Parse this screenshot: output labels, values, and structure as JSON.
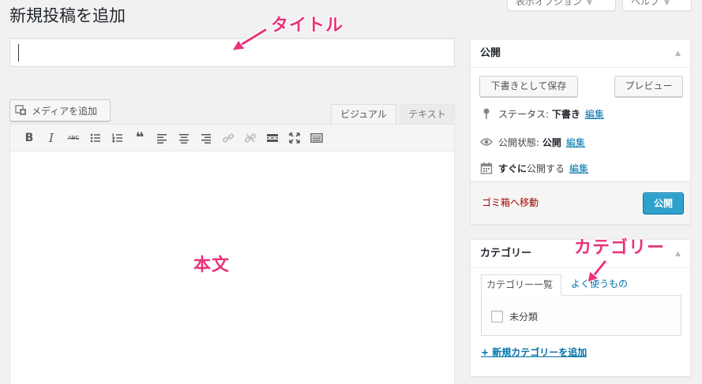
{
  "header": {
    "page_title": "新規投稿を追加",
    "screen_options_label": "表示オプション",
    "help_label": "ヘルプ"
  },
  "title_field": {
    "value": ""
  },
  "media": {
    "add_media_label": "メディアを追加"
  },
  "editor_tabs": {
    "visual": "ビジュアル",
    "text": "テキスト"
  },
  "toolbar": {
    "buttons": [
      "bold-icon",
      "italic-icon",
      "strikethrough-icon",
      "bullet-list-icon",
      "numbered-list-icon",
      "blockquote-icon",
      "align-left-icon",
      "align-center-icon",
      "align-right-icon",
      "insert-link-icon",
      "remove-link-icon",
      "read-more-icon",
      "fullscreen-icon",
      "toolbar-toggle-icon"
    ],
    "bold_glyph": "B",
    "italic_glyph": "I",
    "strike_glyph": "ABC",
    "quote_glyph": "❝"
  },
  "annotations": {
    "title": "タイトル",
    "body": "本文",
    "category": "カテゴリー",
    "color": "#e8327c"
  },
  "publish_box": {
    "heading": "公開",
    "save_draft": "下書きとして保存",
    "preview": "プレビュー",
    "status_label": "ステータス:",
    "status_value": "下書き",
    "visibility_label": "公開状態:",
    "visibility_value": "公開",
    "schedule_value": "すぐに",
    "schedule_label": "公開する",
    "edit_label": "編集",
    "trash_label": "ゴミ箱へ移動",
    "publish_button": "公開",
    "publish_color": "#2ea2cc"
  },
  "category_box": {
    "heading": "カテゴリー",
    "tab_all": "カテゴリー一覧",
    "tab_popular": "よく使うもの",
    "items": [
      {
        "label": "未分類",
        "checked": false
      }
    ],
    "add_new": "+ 新規カテゴリーを追加"
  }
}
